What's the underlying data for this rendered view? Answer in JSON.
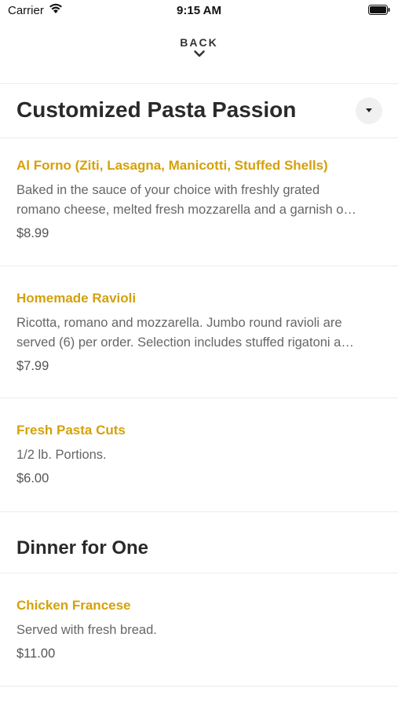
{
  "status_bar": {
    "carrier": "Carrier",
    "time": "9:15 AM"
  },
  "nav": {
    "back_label": "BACK"
  },
  "sections": [
    {
      "title": "Customized Pasta Passion",
      "items": [
        {
          "name": "Al Forno (Ziti, Lasagna, Manicotti, Stuffed Shells)",
          "desc_line1": "Baked in the sauce of your choice with freshly grated",
          "desc_line2": "romano cheese, melted fresh mozzarella and a garnish o…",
          "price": "$8.99"
        },
        {
          "name": "Homemade Ravioli",
          "desc_line1": "Ricotta, romano and mozzarella. Jumbo round ravioli are",
          "desc_line2": "served (6) per order. Selection includes stuffed rigatoni a…",
          "price": "$7.99"
        },
        {
          "name": "Fresh Pasta Cuts",
          "desc_line1": "1/2 lb. Portions.",
          "price": "$6.00"
        }
      ]
    },
    {
      "title": "Dinner for One",
      "items": [
        {
          "name": "Chicken Francese",
          "desc_line1": "Served with fresh bread.",
          "price": "$11.00"
        }
      ]
    }
  ],
  "colors": {
    "accent": "#d4a10a",
    "text_primary": "#2a2a2a",
    "text_secondary": "#666666",
    "divider": "#ececec"
  }
}
